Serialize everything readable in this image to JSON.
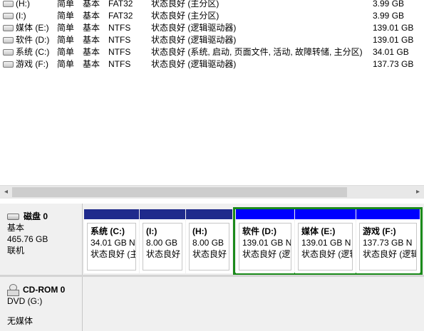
{
  "volumes": [
    {
      "name": "(H:)",
      "layout": "简单",
      "type": "基本",
      "fs": "FAT32",
      "status": "状态良好 (主分区)",
      "capacity": "3.99 GB"
    },
    {
      "name": "(I:)",
      "layout": "简单",
      "type": "基本",
      "fs": "FAT32",
      "status": "状态良好 (主分区)",
      "capacity": "3.99 GB"
    },
    {
      "name": "媒体 (E:)",
      "layout": "简单",
      "type": "基本",
      "fs": "NTFS",
      "status": "状态良好 (逻辑驱动器)",
      "capacity": "139.01 GB"
    },
    {
      "name": "软件 (D:)",
      "layout": "简单",
      "type": "基本",
      "fs": "NTFS",
      "status": "状态良好 (逻辑驱动器)",
      "capacity": "139.01 GB"
    },
    {
      "name": "系统 (C:)",
      "layout": "简单",
      "type": "基本",
      "fs": "NTFS",
      "status": "状态良好 (系统, 启动, 页面文件, 活动, 故障转储, 主分区)",
      "capacity": "34.01 GB"
    },
    {
      "name": "游戏 (F:)",
      "layout": "简单",
      "type": "基本",
      "fs": "NTFS",
      "status": "状态良好 (逻辑驱动器)",
      "capacity": "137.73 GB"
    }
  ],
  "scrollbar": {
    "left": "◂",
    "right": "▸"
  },
  "disk0": {
    "title": "磁盘 0",
    "type": "基本",
    "size": "465.76 GB",
    "state": "联机",
    "partitions": [
      {
        "name": "系统 (C:)",
        "size": "34.01 GB N",
        "status": "状态良好 (主",
        "kind": "primary"
      },
      {
        "name": "(I:)",
        "size": "8.00 GB",
        "status": "状态良好",
        "kind": "primary"
      },
      {
        "name": "(H:)",
        "size": "8.00 GB",
        "status": "状态良好",
        "kind": "primary"
      },
      {
        "name": "软件 (D:)",
        "size": "139.01 GB N",
        "status": "状态良好 (逻",
        "kind": "logical"
      },
      {
        "name": "媒体 (E:)",
        "size": "139.01 GB N",
        "status": "状态良好 (逻辑",
        "kind": "logical"
      },
      {
        "name": "游戏 (F:)",
        "size": "137.73 GB N",
        "status": "状态良好 (逻辑",
        "kind": "logical"
      }
    ]
  },
  "cdrom": {
    "title": "CD-ROM 0",
    "drive": "DVD (G:)",
    "media": "无媒体"
  },
  "colors": {
    "primary_bar": "#1f2a8c",
    "logical_bar": "#0000ff",
    "extended_frame": "#1a8a1a"
  }
}
